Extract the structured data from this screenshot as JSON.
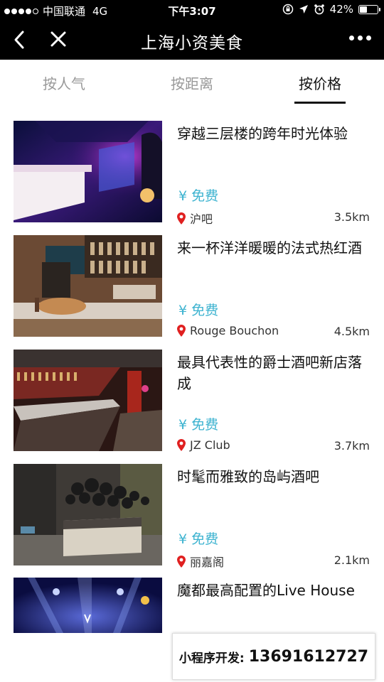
{
  "status_bar": {
    "carrier": "中国联通",
    "network": "4G",
    "time": "下午3:07",
    "battery": "42%",
    "battery_level": 0.42
  },
  "nav": {
    "title": "上海小资美食",
    "back_icon": "chevron-left-icon",
    "close_icon": "close-icon",
    "more_icon": "more-icon"
  },
  "tabs": [
    {
      "label": "按人气",
      "active": false
    },
    {
      "label": "按距离",
      "active": false
    },
    {
      "label": "按价格",
      "active": true
    }
  ],
  "items": [
    {
      "title": "穿越三层楼的跨年时光体验",
      "price": "¥  免费",
      "location": "沪吧",
      "distance": "3.5km"
    },
    {
      "title": "来一杯洋洋暖暖的法式热红酒",
      "price": "¥  免费",
      "location": "Rouge Bouchon",
      "distance": "4.5km"
    },
    {
      "title": "最具代表性的爵士酒吧新店落成",
      "price": "¥  免费",
      "location": "JZ Club",
      "distance": "3.7km"
    },
    {
      "title": "时髦而雅致的岛屿酒吧",
      "price": "¥  免费",
      "location": "丽嘉阁",
      "distance": "2.1km"
    },
    {
      "title": "魔都最高配置的Live House",
      "price": "",
      "location": "",
      "distance": ""
    }
  ],
  "badge": {
    "label": "小程序开发:",
    "phone": "13691612727"
  },
  "colors": {
    "accent": "#3db3d0",
    "pin": "#e02020",
    "bar": "#000000"
  }
}
